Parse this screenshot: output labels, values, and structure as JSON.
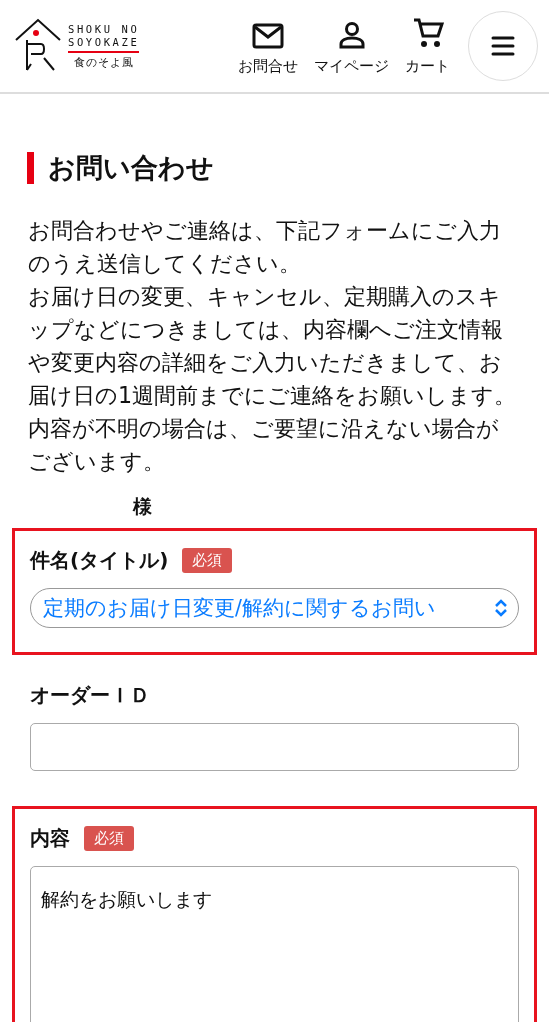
{
  "header": {
    "logo": {
      "romaji_line_1": "SHOKU NO",
      "romaji_line_2": "SOYOKAZE",
      "name": "食のそよ風"
    },
    "nav": [
      {
        "kind": "mail",
        "label": "お問合せ"
      },
      {
        "kind": "user",
        "label": "マイページ"
      },
      {
        "kind": "cart",
        "label": "カート"
      }
    ]
  },
  "page": {
    "heading": "お問い合わせ",
    "paragraphs": [
      "お問合わせやご連絡は、下記フォームにご入力のうえ送信してください。",
      "お届け日の変更、キャンセル、定期購入のスキップなどにつきましては、内容欄へご注文情報や変更内容の詳細をご入力いただきまして、お届け日の1週間前までにご連絡をお願いします。",
      "内容が不明の場合は、ご要望に沿えない場合がございます。"
    ],
    "honorific": "様"
  },
  "form": [
    {
      "kind": "select",
      "label": "件名(タイトル)",
      "required_badge": "必須",
      "value": "定期のお届け日変更/解約に関するお問い",
      "highlighted": true
    },
    {
      "kind": "input",
      "label": "オーダーＩＤ",
      "highlighted": false
    },
    {
      "kind": "textarea",
      "label": "内容",
      "required_badge": "必須",
      "value": "解約をお願いします",
      "highlighted": true
    }
  ]
}
